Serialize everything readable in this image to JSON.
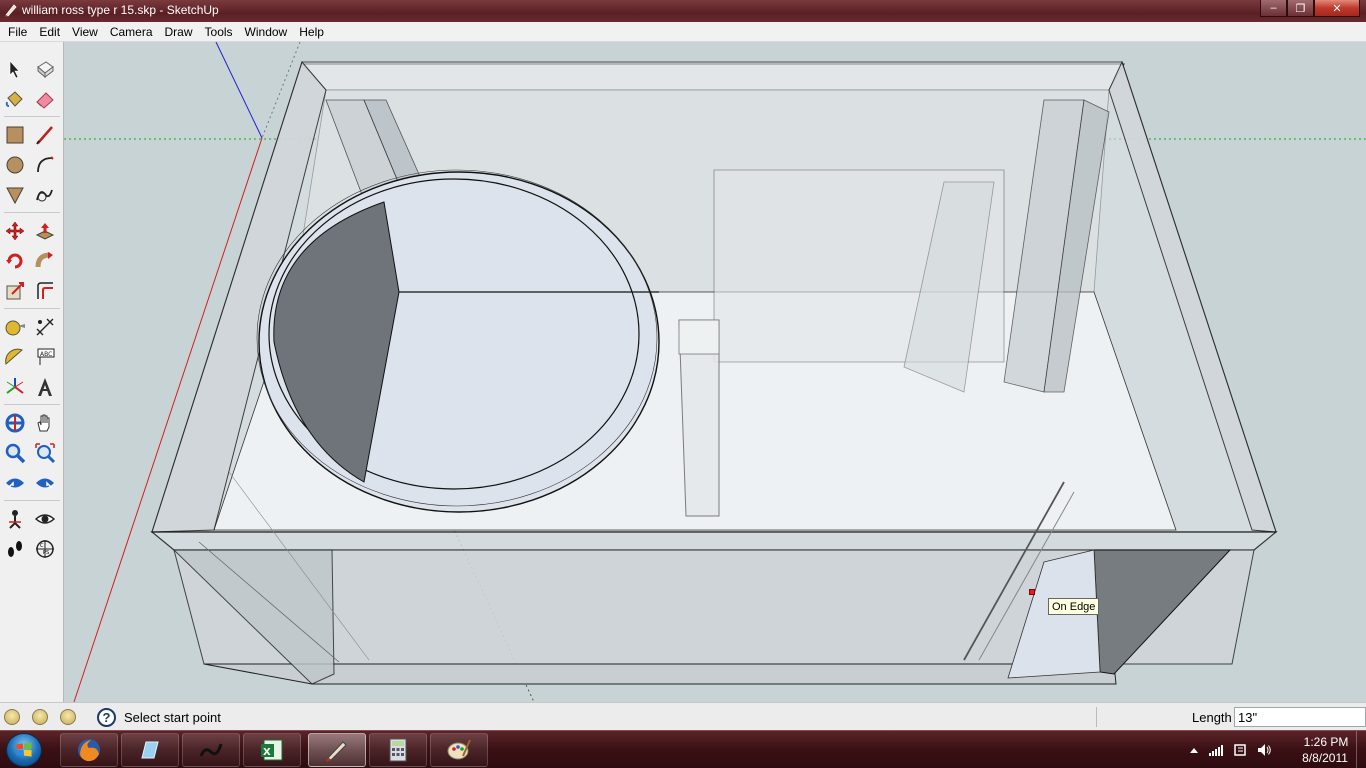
{
  "window": {
    "title": "william ross type r 15.skp - SketchUp",
    "controls": {
      "minimize": "–",
      "maximize": "❐",
      "close": "✕"
    }
  },
  "menubar": {
    "items": [
      "File",
      "Edit",
      "View",
      "Camera",
      "Draw",
      "Tools",
      "Window",
      "Help"
    ]
  },
  "toolbar": {
    "tools": [
      "select",
      "make-component",
      "paint-bucket",
      "eraser",
      "rectangle",
      "line",
      "circle",
      "arc",
      "polygon",
      "freehand",
      "move",
      "push-pull",
      "rotate",
      "follow-me",
      "scale",
      "offset",
      "tape-measure",
      "dimension",
      "protractor",
      "text",
      "axes",
      "3d-text",
      "orbit",
      "pan",
      "zoom",
      "zoom-extents",
      "previous-view",
      "next-view",
      "position-camera",
      "look-around",
      "walk",
      "section-plane"
    ]
  },
  "viewport": {
    "tooltip": "On Edge",
    "background": "#c8d3d6"
  },
  "statusbar": {
    "help_icon": "?",
    "status_text": "Select start point",
    "length_label": "Length",
    "length_value": "13\""
  },
  "taskbar": {
    "apps": [
      "firefox",
      "glass-app",
      "ink-app",
      "excel",
      "sketchup",
      "calculator",
      "paint"
    ],
    "active_app": "sketchup",
    "clock_time": "1:26 PM",
    "clock_date": "8/8/2011"
  },
  "colors": {
    "titlebar": "#5a1f24",
    "taskbar": "#3a1014",
    "axis_red": "#d02020",
    "axis_green": "#20a020",
    "axis_blue": "#2020d0"
  }
}
